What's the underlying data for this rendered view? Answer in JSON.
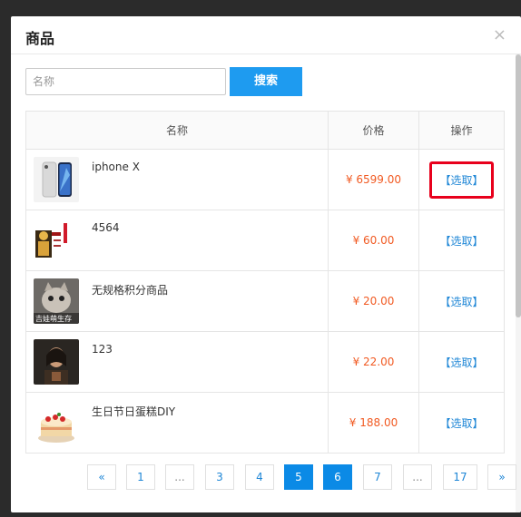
{
  "dialog": {
    "title": "商品",
    "close_glyph": "×"
  },
  "search": {
    "placeholder": "名称",
    "button_label": "搜索"
  },
  "table": {
    "headers": {
      "name": "名称",
      "price": "价格",
      "action": "操作"
    },
    "rows": [
      {
        "name": "iphone X",
        "price": "¥ 6599.00",
        "action": "【选取】",
        "image": "phone-product-image",
        "highlighted": true
      },
      {
        "name": "4564",
        "price": "¥ 60.00",
        "action": "【选取】",
        "image": "poster-product-image",
        "highlighted": false
      },
      {
        "name": "无规格积分商品",
        "price": "¥ 20.00",
        "action": "【选取】",
        "image": "cat-product-image",
        "image_caption": "吉娃萌生存",
        "highlighted": false
      },
      {
        "name": "123",
        "price": "¥ 22.00",
        "action": "【选取】",
        "image": "portrait-product-image",
        "highlighted": false
      },
      {
        "name": "生日节日蛋糕DIY",
        "price": "¥ 188.00",
        "action": "【选取】",
        "image": "cake-product-image",
        "highlighted": false
      }
    ]
  },
  "pagination": {
    "prev": "«",
    "next": "»",
    "pages": [
      "1",
      "...",
      "3",
      "4",
      "5",
      "6",
      "7",
      "...",
      "17"
    ],
    "active_pages": [
      "5",
      "6"
    ]
  },
  "colors": {
    "accent": "#1e9bf0",
    "price": "#f15a22",
    "highlight_border": "#e8001c",
    "active_page": "#0b8ae6"
  }
}
